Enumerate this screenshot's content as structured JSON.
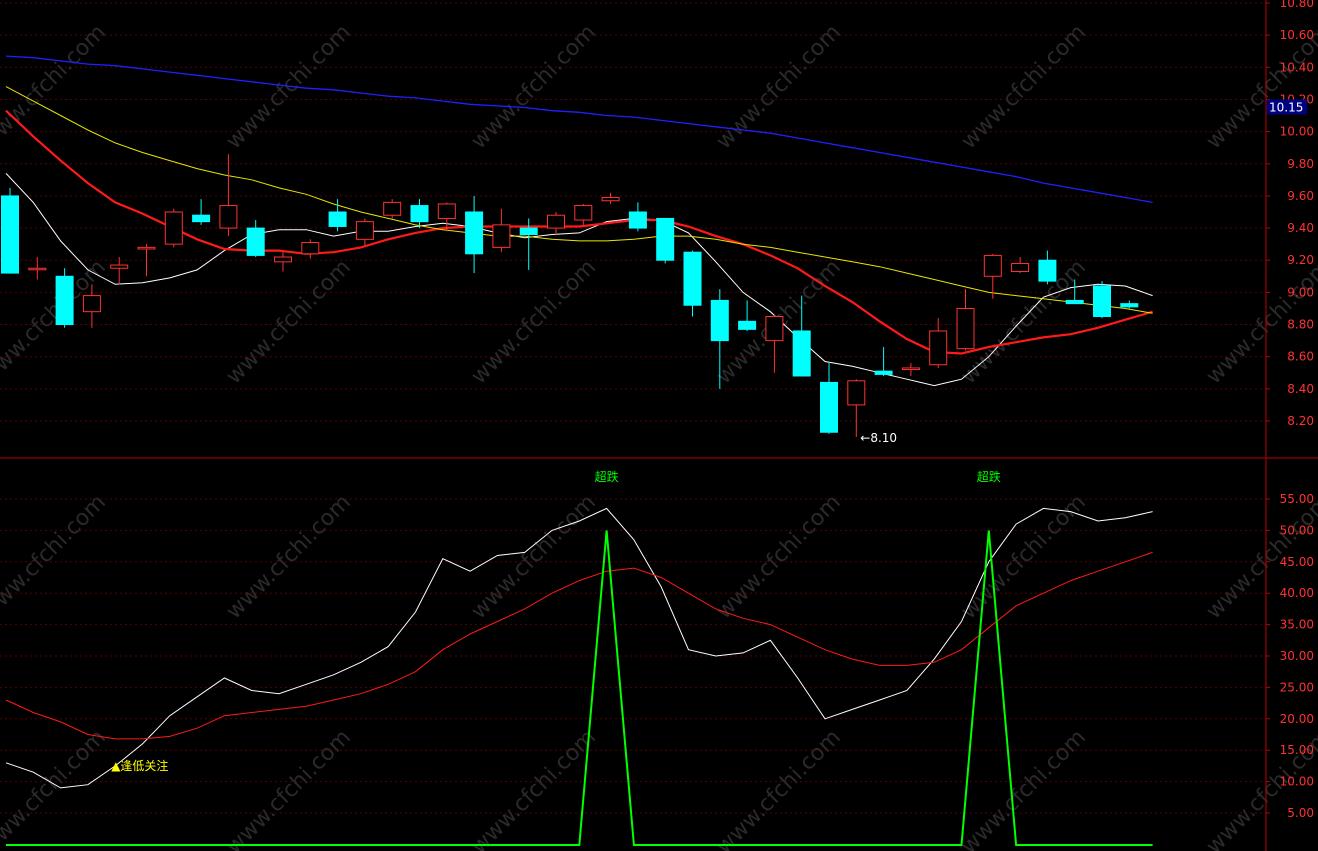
{
  "watermark": "www.cfchi.com",
  "colors": {
    "background": "#000000",
    "grid": "#5a0000",
    "axis_text": "#ff3232",
    "up_candle": "#ff3232",
    "down_candle": "#00ffff",
    "ma_short": "#ffffff",
    "ma_mid": "#ff1a1a",
    "ma_long_yellow": "#e6e600",
    "ma_long_blue": "#2020ff",
    "indicator_main": "#ffffff",
    "indicator_signal": "#ff1a1a",
    "indicator_trigger": "#00ff00",
    "annotation_yellow": "#ffff00",
    "price_tag_bg": "#000080"
  },
  "chart_data": [
    {
      "type": "candlestick",
      "ylim": [
        8.0,
        10.8
      ],
      "yticks": [
        "10.80",
        "10.60",
        "10.40",
        "10.20",
        "10.00",
        "9.80",
        "9.60",
        "9.40",
        "9.20",
        "9.00",
        "8.80",
        "8.60",
        "8.40",
        "8.20"
      ],
      "price_tag": "10.15",
      "low_marker": "←8.10",
      "candles": [
        {
          "open": 9.6,
          "high": 9.65,
          "low": 9.12,
          "close": 9.12
        },
        {
          "open": 9.15,
          "high": 9.22,
          "low": 9.08,
          "close": 9.15
        },
        {
          "open": 9.1,
          "high": 9.15,
          "low": 8.78,
          "close": 8.8
        },
        {
          "open": 8.88,
          "high": 9.05,
          "low": 8.78,
          "close": 8.98
        },
        {
          "open": 9.15,
          "high": 9.22,
          "low": 9.05,
          "close": 9.17
        },
        {
          "open": 9.27,
          "high": 9.3,
          "low": 9.1,
          "close": 9.28
        },
        {
          "open": 9.3,
          "high": 9.52,
          "low": 9.28,
          "close": 9.5
        },
        {
          "open": 9.48,
          "high": 9.58,
          "low": 9.42,
          "close": 9.44
        },
        {
          "open": 9.4,
          "high": 9.86,
          "low": 9.35,
          "close": 9.54
        },
        {
          "open": 9.4,
          "high": 9.45,
          "low": 9.22,
          "close": 9.23
        },
        {
          "open": 9.19,
          "high": 9.25,
          "low": 9.13,
          "close": 9.22
        },
        {
          "open": 9.24,
          "high": 9.33,
          "low": 9.21,
          "close": 9.31
        },
        {
          "open": 9.5,
          "high": 9.58,
          "low": 9.38,
          "close": 9.41
        },
        {
          "open": 9.33,
          "high": 9.46,
          "low": 9.29,
          "close": 9.44
        },
        {
          "open": 9.48,
          "high": 9.58,
          "low": 9.46,
          "close": 9.56
        },
        {
          "open": 9.54,
          "high": 9.58,
          "low": 9.4,
          "close": 9.44
        },
        {
          "open": 9.46,
          "high": 9.56,
          "low": 9.38,
          "close": 9.55
        },
        {
          "open": 9.5,
          "high": 9.6,
          "low": 9.12,
          "close": 9.24
        },
        {
          "open": 9.28,
          "high": 9.52,
          "low": 9.25,
          "close": 9.42
        },
        {
          "open": 9.4,
          "high": 9.46,
          "low": 9.14,
          "close": 9.36
        },
        {
          "open": 9.4,
          "high": 9.5,
          "low": 9.36,
          "close": 9.48
        },
        {
          "open": 9.45,
          "high": 9.55,
          "low": 9.42,
          "close": 9.54
        },
        {
          "open": 9.57,
          "high": 9.62,
          "low": 9.55,
          "close": 9.59
        },
        {
          "open": 9.5,
          "high": 9.56,
          "low": 9.38,
          "close": 9.4
        },
        {
          "open": 9.46,
          "high": 9.46,
          "low": 9.18,
          "close": 9.2
        },
        {
          "open": 9.25,
          "high": 9.26,
          "low": 8.85,
          "close": 8.92
        },
        {
          "open": 8.95,
          "high": 9.02,
          "low": 8.4,
          "close": 8.7
        },
        {
          "open": 8.82,
          "high": 8.95,
          "low": 8.76,
          "close": 8.77
        },
        {
          "open": 8.7,
          "high": 8.86,
          "low": 8.5,
          "close": 8.85
        },
        {
          "open": 8.76,
          "high": 8.98,
          "low": 8.48,
          "close": 8.48
        },
        {
          "open": 8.44,
          "high": 8.56,
          "low": 8.12,
          "close": 8.13
        },
        {
          "open": 8.3,
          "high": 8.46,
          "low": 8.1,
          "close": 8.45
        },
        {
          "open": 8.51,
          "high": 8.66,
          "low": 8.48,
          "close": 8.49
        },
        {
          "open": 8.52,
          "high": 8.56,
          "low": 8.48,
          "close": 8.53
        },
        {
          "open": 8.55,
          "high": 8.84,
          "low": 8.53,
          "close": 8.76
        },
        {
          "open": 8.65,
          "high": 9.02,
          "low": 8.64,
          "close": 8.9
        },
        {
          "open": 9.1,
          "high": 9.24,
          "low": 8.96,
          "close": 9.23
        },
        {
          "open": 9.13,
          "high": 9.22,
          "low": 9.12,
          "close": 9.18
        },
        {
          "open": 9.2,
          "high": 9.26,
          "low": 9.05,
          "close": 9.07
        },
        {
          "open": 8.95,
          "high": 9.08,
          "low": 8.93,
          "close": 8.93
        },
        {
          "open": 9.04,
          "high": 9.07,
          "low": 8.84,
          "close": 8.85
        },
        {
          "open": 8.93,
          "high": 8.95,
          "low": 8.9,
          "close": 8.91
        }
      ],
      "series": [
        {
          "key": "ma_short",
          "values": [
            9.74,
            9.56,
            9.32,
            9.14,
            9.05,
            9.06,
            9.09,
            9.14,
            9.26,
            9.36,
            9.39,
            9.39,
            9.35,
            9.38,
            9.38,
            9.41,
            9.43,
            9.41,
            9.37,
            9.34,
            9.36,
            9.37,
            9.44,
            9.46,
            9.45,
            9.37,
            9.19,
            9.0,
            8.88,
            8.72,
            8.57,
            8.54,
            8.5,
            8.46,
            8.42,
            8.46,
            8.6,
            8.79,
            8.97,
            9.03,
            9.05,
            9.04,
            8.98
          ]
        },
        {
          "key": "ma_mid",
          "values": [
            10.13,
            9.97,
            9.82,
            9.68,
            9.56,
            9.49,
            9.41,
            9.33,
            9.27,
            9.26,
            9.26,
            9.24,
            9.25,
            9.28,
            9.33,
            9.37,
            9.4,
            9.41,
            9.41,
            9.41,
            9.41,
            9.41,
            9.43,
            9.45,
            9.45,
            9.41,
            9.35,
            9.3,
            9.23,
            9.15,
            9.04,
            8.94,
            8.82,
            8.71,
            8.63,
            8.62,
            8.66,
            8.69,
            8.72,
            8.74,
            8.78,
            8.83,
            8.88
          ]
        },
        {
          "key": "ma_long_yellow",
          "values": [
            10.28,
            10.19,
            10.1,
            10.01,
            9.93,
            9.87,
            9.82,
            9.77,
            9.73,
            9.7,
            9.65,
            9.61,
            9.55,
            9.5,
            9.46,
            9.42,
            9.39,
            9.37,
            9.35,
            9.35,
            9.33,
            9.32,
            9.32,
            9.33,
            9.35,
            9.35,
            9.33,
            9.3,
            9.28,
            9.25,
            9.22,
            9.19,
            9.16,
            9.12,
            9.08,
            9.04,
            9.0,
            8.98,
            8.96,
            8.94,
            8.92,
            8.9,
            8.87
          ]
        },
        {
          "key": "ma_long_blue",
          "values": [
            10.47,
            10.46,
            10.44,
            10.42,
            10.41,
            10.39,
            10.37,
            10.35,
            10.33,
            10.31,
            10.29,
            10.27,
            10.26,
            10.24,
            10.22,
            10.21,
            10.19,
            10.17,
            10.16,
            10.15,
            10.13,
            10.12,
            10.1,
            10.09,
            10.07,
            10.05,
            10.03,
            10.01,
            9.99,
            9.96,
            9.93,
            9.9,
            9.87,
            9.84,
            9.81,
            9.78,
            9.75,
            9.72,
            9.68,
            9.65,
            9.62,
            9.59,
            9.56
          ]
        }
      ]
    },
    {
      "type": "line",
      "ylim": [
        0,
        60
      ],
      "yticks": [
        "55.00",
        "50.00",
        "45.00",
        "40.00",
        "35.00",
        "30.00",
        "25.00",
        "20.00",
        "15.00",
        "10.00",
        "5.00"
      ],
      "annotations": [
        {
          "text": "▲逢低关注",
          "index": 4,
          "value": 12.5
        },
        {
          "text": "超跌",
          "index": 22,
          "value": 58.5
        },
        {
          "text": "超跌",
          "index": 36,
          "value": 58.5
        }
      ],
      "series": [
        {
          "key": "indicator_main",
          "values": [
            13.0,
            11.5,
            9.0,
            9.5,
            12.5,
            16.0,
            20.5,
            23.5,
            26.5,
            24.5,
            24.0,
            25.5,
            27.0,
            29.0,
            31.5,
            37.0,
            45.5,
            43.5,
            46.0,
            46.5,
            50.0,
            51.5,
            53.5,
            48.5,
            41.0,
            31.0,
            30.0,
            30.5,
            32.5,
            26.5,
            20.0,
            21.5,
            23.0,
            24.5,
            29.5,
            35.5,
            45.0,
            51.0,
            53.5,
            53.0,
            51.5,
            52.0,
            53.0
          ]
        },
        {
          "key": "indicator_signal",
          "values": [
            23.0,
            21.0,
            19.5,
            17.5,
            16.8,
            16.8,
            17.2,
            18.5,
            20.5,
            21.0,
            21.5,
            22.0,
            23.0,
            24.0,
            25.5,
            27.5,
            31.0,
            33.5,
            35.5,
            37.5,
            40.0,
            42.0,
            43.5,
            44.0,
            42.5,
            40.0,
            37.5,
            36.0,
            35.0,
            33.0,
            31.0,
            29.5,
            28.5,
            28.5,
            29.0,
            31.0,
            34.5,
            38.0,
            40.0,
            42.0,
            43.5,
            45.0,
            46.5
          ]
        },
        {
          "key": "indicator_trigger",
          "values": [
            0,
            0,
            0,
            0,
            0,
            0,
            0,
            0,
            0,
            0,
            0,
            0,
            0,
            0,
            0,
            0,
            0,
            0,
            0,
            0,
            0,
            0,
            50,
            0,
            0,
            0,
            0,
            0,
            0,
            0,
            0,
            0,
            0,
            0,
            0,
            0,
            50,
            0,
            0,
            0,
            0,
            0,
            0
          ]
        }
      ]
    }
  ]
}
